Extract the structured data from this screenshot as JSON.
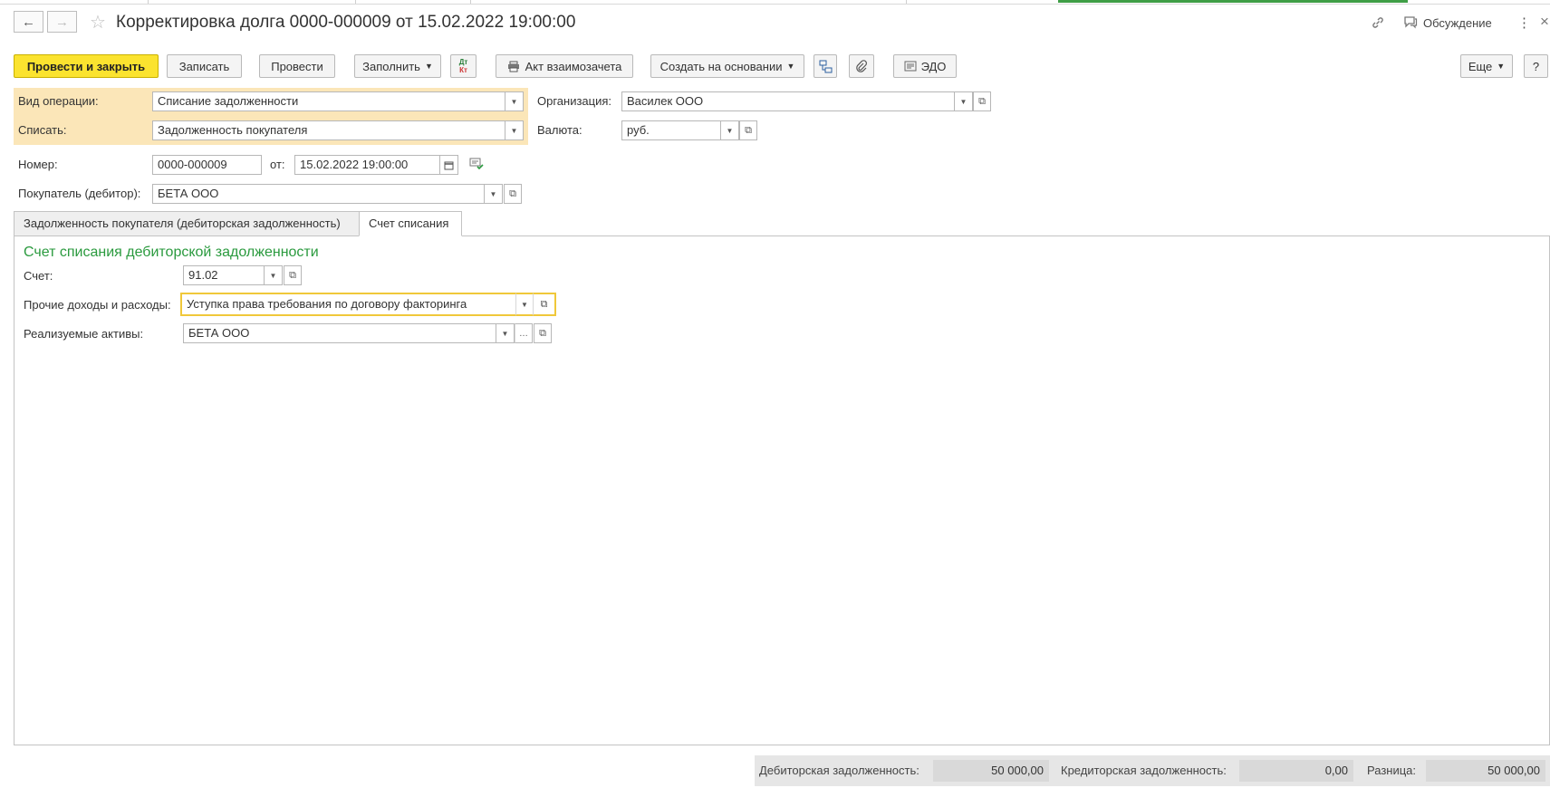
{
  "header": {
    "title": "Корректировка долга 0000-000009 от 15.02.2022 19:00:00",
    "discussion_label": "Обсуждение",
    "icons": {
      "back": "back-arrow-icon",
      "forward": "forward-arrow-icon",
      "favorite": "star-icon",
      "link": "link-icon",
      "discussion": "chat-icon",
      "menu": "more-vert-icon",
      "close": "close-icon"
    }
  },
  "toolbar": {
    "post_close": "Провести и закрыть",
    "save": "Записать",
    "post": "Провести",
    "fill": "Заполнить",
    "dtkt_top": "Дт",
    "dtkt_bottom": "Кт",
    "act": "Акт взаимозачета",
    "create_based": "Создать на основании",
    "edo": "ЭДО",
    "more": "Еще",
    "help": "?"
  },
  "form": {
    "operation_label": "Вид операции:",
    "operation_value": "Списание задолженности",
    "writeoff_label": "Списать:",
    "writeoff_value": "Задолженность покупателя",
    "org_label": "Организация:",
    "org_value": "Василек ООО",
    "currency_label": "Валюта:",
    "currency_value": "руб.",
    "number_label": "Номер:",
    "number_value": "0000-000009",
    "date_label": "от:",
    "date_value": "15.02.2022 19:00:00",
    "buyer_label": "Покупатель (дебитор):",
    "buyer_value": "БЕТА ООО"
  },
  "tabs": [
    {
      "label": "Задолженность покупателя (дебиторская задолженность)",
      "active": false
    },
    {
      "label": "Счет списания",
      "active": true
    }
  ],
  "writeoff_section": {
    "title": "Счет списания дебиторской задолженности",
    "account_label": "Счет:",
    "account_value": "91.02",
    "other_label": "Прочие доходы и расходы:",
    "other_value": "Уступка права требования по договору факторинга",
    "assets_label": "Реализуемые активы:",
    "assets_value": "БЕТА ООО"
  },
  "footer": {
    "debit_label": "Дебиторская задолженность:",
    "debit_value": "50 000,00",
    "credit_label": "Кредиторская задолженность:",
    "credit_value": "0,00",
    "diff_label": "Разница:",
    "diff_value": "50 000,00"
  },
  "colors": {
    "accent_yellow": "#fbe32f",
    "highlight": "#fbe6b8",
    "section_green": "#2a9a3e"
  }
}
